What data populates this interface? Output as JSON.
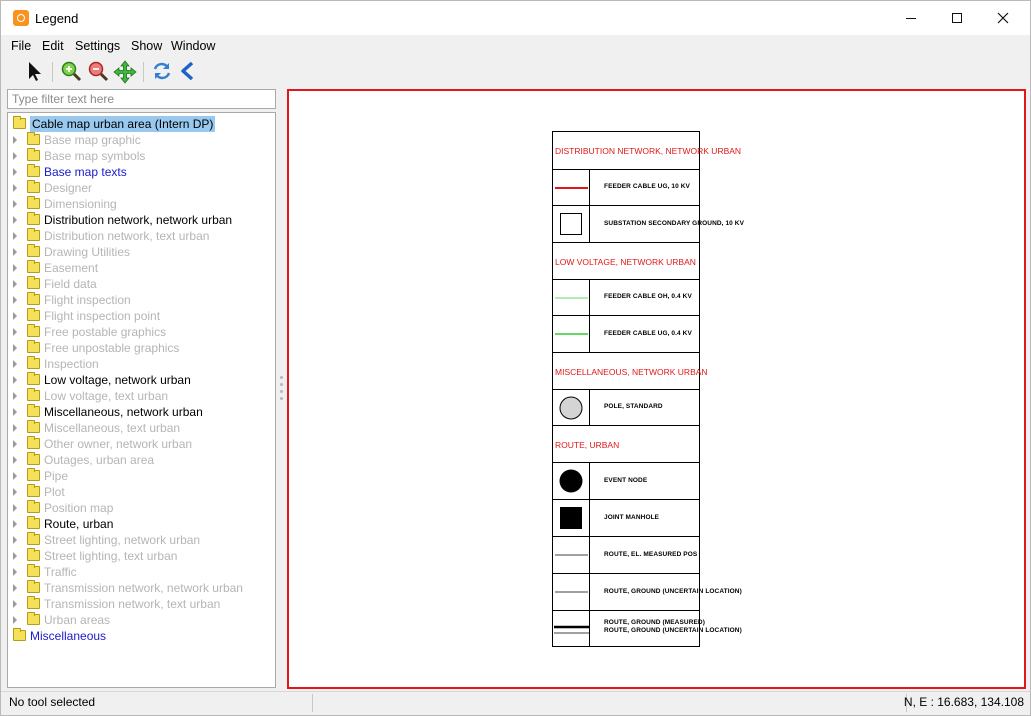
{
  "window": {
    "title": "Legend",
    "controls": {
      "minimize": "minimize-icon",
      "maximize": "maximize-icon",
      "close": "close-icon"
    }
  },
  "menu": [
    "File",
    "Edit",
    "Settings",
    "Show",
    "Window"
  ],
  "toolbar": {
    "tools": [
      "select-pointer-icon",
      "zoom-in-icon",
      "zoom-out-icon",
      "pan-icon",
      "refresh-icon",
      "back-icon"
    ]
  },
  "filter": {
    "placeholder": "Type filter text here",
    "value": ""
  },
  "tree": {
    "items": [
      {
        "label": "Cable map urban area (Intern DP)",
        "level": 0,
        "style": "selected",
        "expand": false
      },
      {
        "label": "Base map graphic",
        "level": 1,
        "style": "gray",
        "expand": true
      },
      {
        "label": "Base map symbols",
        "level": 1,
        "style": "gray",
        "expand": true
      },
      {
        "label": "Base map texts",
        "level": 1,
        "style": "blue",
        "expand": true
      },
      {
        "label": "Designer",
        "level": 1,
        "style": "gray",
        "expand": true
      },
      {
        "label": "Dimensioning",
        "level": 1,
        "style": "gray",
        "expand": true
      },
      {
        "label": "Distribution network, network urban",
        "level": 1,
        "style": "black",
        "expand": true
      },
      {
        "label": "Distribution network, text urban",
        "level": 1,
        "style": "gray",
        "expand": true
      },
      {
        "label": "Drawing Utilities",
        "level": 1,
        "style": "gray",
        "expand": true
      },
      {
        "label": "Easement",
        "level": 1,
        "style": "gray",
        "expand": true
      },
      {
        "label": "Field data",
        "level": 1,
        "style": "gray",
        "expand": true
      },
      {
        "label": "Flight inspection",
        "level": 1,
        "style": "gray",
        "expand": true
      },
      {
        "label": "Flight inspection point",
        "level": 1,
        "style": "gray",
        "expand": true
      },
      {
        "label": "Free postable graphics",
        "level": 1,
        "style": "gray",
        "expand": true
      },
      {
        "label": "Free unpostable graphics",
        "level": 1,
        "style": "gray",
        "expand": true
      },
      {
        "label": "Inspection",
        "level": 1,
        "style": "gray",
        "expand": true
      },
      {
        "label": "Low voltage, network urban",
        "level": 1,
        "style": "black",
        "expand": true
      },
      {
        "label": "Low voltage, text urban",
        "level": 1,
        "style": "gray",
        "expand": true
      },
      {
        "label": "Miscellaneous, network urban",
        "level": 1,
        "style": "black",
        "expand": true
      },
      {
        "label": "Miscellaneous, text urban",
        "level": 1,
        "style": "gray",
        "expand": true
      },
      {
        "label": "Other owner, network urban",
        "level": 1,
        "style": "gray",
        "expand": true
      },
      {
        "label": "Outages, urban area",
        "level": 1,
        "style": "gray",
        "expand": true
      },
      {
        "label": "Pipe",
        "level": 1,
        "style": "gray",
        "expand": true
      },
      {
        "label": "Plot",
        "level": 1,
        "style": "gray",
        "expand": true
      },
      {
        "label": "Position map",
        "level": 1,
        "style": "gray",
        "expand": true
      },
      {
        "label": "Route, urban",
        "level": 1,
        "style": "black",
        "expand": true
      },
      {
        "label": "Street lighting, network urban",
        "level": 1,
        "style": "gray",
        "expand": true
      },
      {
        "label": "Street lighting, text urban",
        "level": 1,
        "style": "gray",
        "expand": true
      },
      {
        "label": "Traffic",
        "level": 1,
        "style": "gray",
        "expand": true
      },
      {
        "label": "Transmission network, network urban",
        "level": 1,
        "style": "gray",
        "expand": true
      },
      {
        "label": "Transmission network, text urban",
        "level": 1,
        "style": "gray",
        "expand": true
      },
      {
        "label": "Urban areas",
        "level": 1,
        "style": "gray",
        "expand": true
      },
      {
        "label": "Miscellaneous",
        "level": 0,
        "style": "blue",
        "expand": false
      }
    ]
  },
  "legend": {
    "colors": {
      "heading": "#e01818",
      "feeder_ug_10kv": "#e01818",
      "feeder_lv": "#33cc33"
    },
    "rows": [
      {
        "kind": "heading",
        "text": "DISTRIBUTION NETWORK, NETWORK URBAN"
      },
      {
        "kind": "item",
        "symbol": "red-line",
        "text": "FEEDER CABLE UG, 10 KV"
      },
      {
        "kind": "item",
        "symbol": "square-outline",
        "text": "SUBSTATION SECONDARY GROUND, 10 KV"
      },
      {
        "kind": "heading",
        "text": "LOW VOLTAGE, NETWORK URBAN"
      },
      {
        "kind": "item",
        "symbol": "green-thin-line",
        "text": "FEEDER CABLE OH, 0.4 KV"
      },
      {
        "kind": "item",
        "symbol": "green-line",
        "text": "FEEDER CABLE UG, 0.4 KV"
      },
      {
        "kind": "heading",
        "text": "MISCELLANEOUS, NETWORK URBAN"
      },
      {
        "kind": "item",
        "symbol": "gray-circle",
        "text": "POLE, STANDARD"
      },
      {
        "kind": "heading",
        "text": "ROUTE, URBAN"
      },
      {
        "kind": "item",
        "symbol": "black-circle",
        "text": "EVENT NODE"
      },
      {
        "kind": "item",
        "symbol": "black-square",
        "text": "JOINT MANHOLE"
      },
      {
        "kind": "item",
        "symbol": "thin-line",
        "text": "ROUTE, EL. MEASURED POS"
      },
      {
        "kind": "item",
        "symbol": "thin-line",
        "text": "ROUTE, GROUND  (UNCERTAIN LOCATION)"
      },
      {
        "kind": "item2",
        "symbol": "thick-over-thin",
        "text": "ROUTE, GROUND (MEASURED)",
        "text2": "ROUTE, GROUND  (UNCERTAIN LOCATION)"
      }
    ]
  },
  "status": {
    "left": "No tool selected",
    "right": "N, E : 16.683, 134.108"
  }
}
